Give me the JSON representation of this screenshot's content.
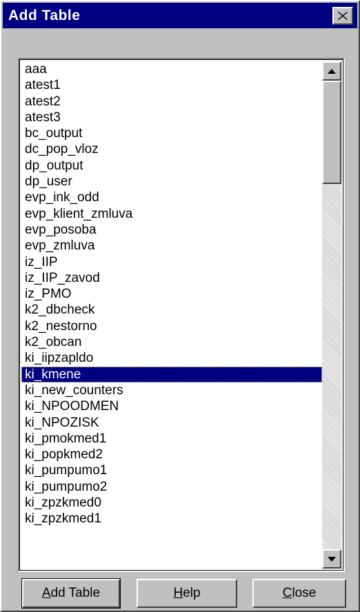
{
  "window": {
    "title": "Add Table",
    "close_icon": "close-icon"
  },
  "table_list": {
    "items": [
      "aaa",
      "atest1",
      "atest2",
      "atest3",
      "bc_output",
      "dc_pop_vloz",
      "dp_output",
      "dp_user",
      "evp_ink_odd",
      "evp_klient_zmluva",
      "evp_posoba",
      "evp_zmluva",
      "iz_IIP",
      "iz_IIP_zavod",
      "iz_PMO",
      "k2_dbcheck",
      "k2_nestorno",
      "k2_obcan",
      "ki_iipzapldo",
      "ki_kmene",
      "ki_new_counters",
      "ki_NPOODMEN",
      "ki_NPOZISK",
      "ki_pmokmed1",
      "ki_popkmed2",
      "ki_pumpumo1",
      "ki_pumpumo2",
      "ki_zpzkmed0",
      "ki_zpzkmed1"
    ],
    "selected_item": "ki_kmene",
    "scroll_position": 0.0
  },
  "buttons": {
    "add_table": {
      "mnemonic": "A",
      "rest": "dd Table"
    },
    "help": {
      "mnemonic": "H",
      "rest": "elp"
    },
    "close": {
      "mnemonic": "C",
      "rest": "lose"
    }
  },
  "colors": {
    "titlebar": "#000080",
    "face": "#c0c0c0",
    "selection": "#000080"
  }
}
